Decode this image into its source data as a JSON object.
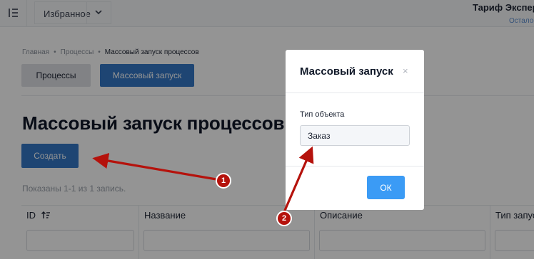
{
  "topbar": {
    "favorites_label": "Избранное",
    "tariff_label": "Тариф Экспер",
    "remaining_label": "Осталос"
  },
  "breadcrumb": {
    "items": [
      "Главная",
      "Процессы",
      "Массовый запуск процессов"
    ],
    "separator": "•"
  },
  "tabs": {
    "processes_label": "Процессы",
    "mass_launch_label": "Массовый запуск"
  },
  "page": {
    "title": "Массовый запуск процессов",
    "create_button_label": "Создать",
    "records_text": "Показаны 1-1 из 1 запись."
  },
  "table": {
    "columns": [
      "ID",
      "Название",
      "Описание",
      "Тип запус"
    ]
  },
  "modal": {
    "title": "Массовый запуск",
    "close_glyph": "×",
    "object_type_label": "Тип объекта",
    "object_type_value": "Заказ",
    "ok_label": "ОК"
  },
  "annotations": {
    "badge_1": "1",
    "badge_2": "2"
  },
  "colors": {
    "primary": "#3478c6",
    "ok_button": "#3b9bf5",
    "annotation_red": "#b5120c",
    "overlay": "rgba(0,0,0,0.42)"
  },
  "icons": [
    "menu-collapse-icon",
    "chevron-down-icon",
    "sort-icon",
    "close-icon"
  ]
}
